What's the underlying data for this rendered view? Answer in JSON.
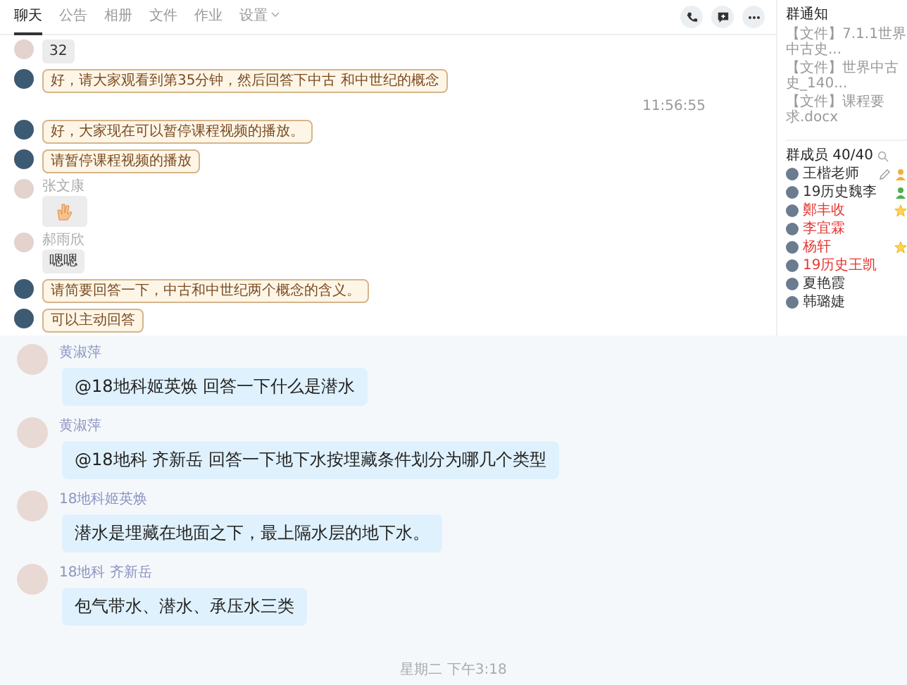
{
  "tabs": [
    {
      "label": "聊天",
      "selected": true,
      "has_menu": false
    },
    {
      "label": "公告",
      "selected": false,
      "has_menu": false
    },
    {
      "label": "相册",
      "selected": false,
      "has_menu": false
    },
    {
      "label": "文件",
      "selected": false,
      "has_menu": false
    },
    {
      "label": "作业",
      "selected": false,
      "has_menu": false
    },
    {
      "label": "设置",
      "selected": false,
      "has_menu": true
    }
  ],
  "top_messages": [
    {
      "kind": "text",
      "text": "32"
    },
    {
      "kind": "notice",
      "text": "好，请大家观看到第35分钟，然后回答下中古 和中世纪的概念"
    },
    {
      "kind": "time",
      "text": "11:56:55"
    },
    {
      "kind": "notice",
      "text": "好，大家现在可以暂停课程视频的播放。"
    },
    {
      "kind": "notice",
      "text": "请暂停课程视频的播放"
    },
    {
      "kind": "sticker",
      "sender": "张文康"
    },
    {
      "kind": "text",
      "sender": "郝雨欣",
      "text": "嗯嗯"
    },
    {
      "kind": "notice",
      "text": "请简要回答一下，中古和中世纪两个概念的含义。"
    },
    {
      "kind": "notice",
      "text": "可以主动回答"
    }
  ],
  "sidebar": {
    "notice_title": "群通知",
    "files": [
      "【文件】7.1.1世界中古史...",
      "【文件】世界中古史_140...",
      "【文件】课程要求.docx"
    ],
    "members_title": "群成员 40/40",
    "members": [
      {
        "name": "王楷老师",
        "color": "#333333",
        "kind": "owner"
      },
      {
        "name": "19历史魏李",
        "color": "#333333",
        "kind": "admin"
      },
      {
        "name": "鄭丰收",
        "color": "#e53935",
        "kind": "starred"
      },
      {
        "name": "李宜霖",
        "color": "#e53935",
        "kind": "plain"
      },
      {
        "name": "杨轩",
        "color": "#e53935",
        "kind": "starred"
      },
      {
        "name": "19历史王凯",
        "color": "#e53935",
        "kind": "plain"
      },
      {
        "name": "夏艳霞",
        "color": "#333333",
        "kind": "plain"
      },
      {
        "name": "韩璐婕",
        "color": "#333333",
        "kind": "plain"
      }
    ]
  },
  "conversation": [
    {
      "sender": "黄淑萍",
      "text": "@18地科姬英焕 回答一下什么是潜水"
    },
    {
      "sender": "黄淑萍",
      "text": "@18地科 齐新岳 回答一下地下水按埋藏条件划分为哪几个类型"
    },
    {
      "sender": "18地科姬英焕",
      "text": "潜水是埋藏在地面之下，最上隔水层的地下水。"
    },
    {
      "sender": "18地科 齐新岳",
      "text": "包气带水、潜水、承压水三类"
    }
  ],
  "date_divider": "星期二 下午3:18"
}
